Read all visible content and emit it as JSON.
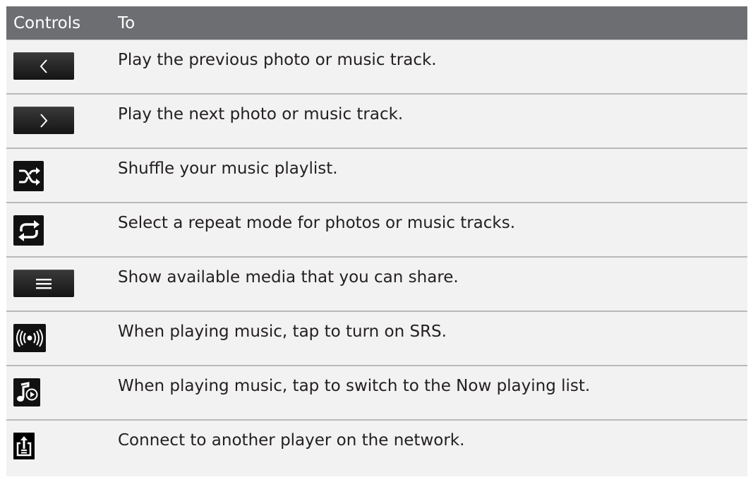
{
  "header": {
    "col_controls": "Controls",
    "col_to": "To"
  },
  "rows": [
    {
      "icon": "previous-icon",
      "text": "Play the previous photo or music track."
    },
    {
      "icon": "next-icon",
      "text": "Play the next photo or music track."
    },
    {
      "icon": "shuffle-icon",
      "text": "Shuffle your music playlist."
    },
    {
      "icon": "repeat-icon",
      "text": "Select a repeat mode for photos or music tracks."
    },
    {
      "icon": "menu-icon",
      "text": "Show available media that you can share."
    },
    {
      "icon": "srs-icon",
      "text": "When playing music, tap to turn on SRS."
    },
    {
      "icon": "now-playing-icon",
      "text": "When playing music, tap to switch to the Now playing list."
    },
    {
      "icon": "connect-player-icon",
      "text": "Connect to another player on the network."
    }
  ],
  "colors": {
    "header_bg": "#6d6e71",
    "table_bg": "#f2f2f2",
    "divider": "#b9b9b9",
    "text": "#231f20"
  }
}
